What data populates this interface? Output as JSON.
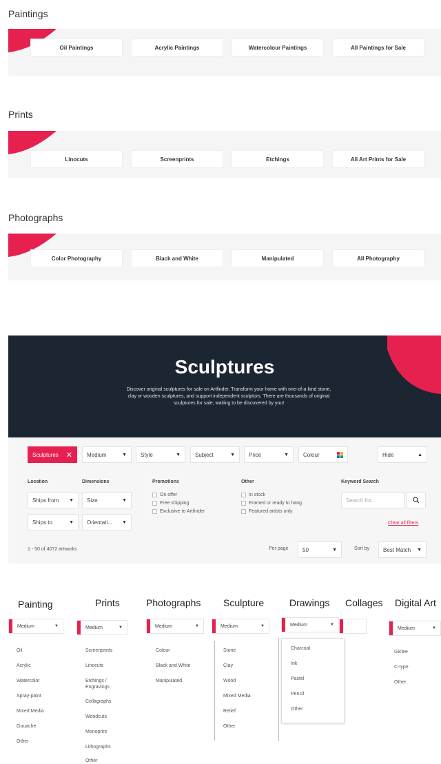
{
  "sections": [
    {
      "title": "Paintings",
      "buttons": [
        "Oil Paintings",
        "Acrylic Paintings",
        "Watercolour Paintings",
        "All Paintings for Sale"
      ]
    },
    {
      "title": "Prints",
      "buttons": [
        "Linocuts",
        "Screenprints",
        "Etchings",
        "All Art Prints for Sale"
      ]
    },
    {
      "title": "Photographs",
      "buttons": [
        "Color Photography",
        "Black and White",
        "Manipulated",
        "All Photography"
      ]
    }
  ],
  "hero": {
    "title": "Sculptures",
    "description": "Discover original sculptures for sale on Artfinder. Transform your home with one-of-a-kind stone, clay or wooden sculptures, and support independent sculptors. There are thousands of original sculptures for sale, waiting to be discovered by you!"
  },
  "filters": {
    "active_chip": "Sculptures",
    "top": [
      "Medium",
      "Style",
      "Subject",
      "Price",
      "Colour"
    ],
    "hide": "Hide",
    "location_label": "Location",
    "ships_from": "Ships from",
    "ships_to": "Ships to",
    "dimensions_label": "Dimensions",
    "size": "Size",
    "orientation": "Orientati...",
    "promotions_label": "Promotions",
    "promotions": [
      "On offer",
      "Free shipping",
      "Exclusive to Artfinder"
    ],
    "other_label": "Other",
    "other": [
      "In stock",
      "Framed or ready to hang",
      "Featured artists only"
    ],
    "keyword_label": "Keyword Search",
    "search_placeholder": "Search for...",
    "clear": "Clear all filters",
    "count": "1 - 50 of 4072 artworks",
    "per_page_label": "Per page",
    "per_page_value": "50",
    "sort_label": "Sort by",
    "sort_value": "Best Match"
  },
  "menus": {
    "select_label": "Medium",
    "columns": [
      {
        "title": "Painting",
        "items": [
          "Oil",
          "Acrylic",
          "Watercolor",
          "Spray-paint",
          "Mixed Media",
          "Gouache",
          "Other"
        ]
      },
      {
        "title": "Prints",
        "items": [
          "Screenprints",
          "Linocuts",
          "Etchings / Engravings",
          "Collagraphs",
          "Woodcuts",
          "Monoprint",
          "Lithographs",
          "Other"
        ]
      },
      {
        "title": "Photographs",
        "items": [
          "Colour",
          "Black and White",
          "Manipulated"
        ]
      },
      {
        "title": "Sculpture",
        "items": [
          "Stone",
          "Clay",
          "Wood",
          "Mixed Media",
          "Relief",
          "Other"
        ]
      },
      {
        "title": "Drawings",
        "items": [
          "Charcoal",
          "Ink",
          "Pastel",
          "Pencil",
          "Other"
        ]
      },
      {
        "title": "Collages",
        "items": []
      },
      {
        "title": "Digital Art",
        "items": [
          "Giclee",
          "C-type",
          "Other"
        ]
      }
    ]
  },
  "colors": {
    "accent": "#e6214f",
    "hero_bg": "#1b2632",
    "panel_bg": "#f5f5f5"
  }
}
